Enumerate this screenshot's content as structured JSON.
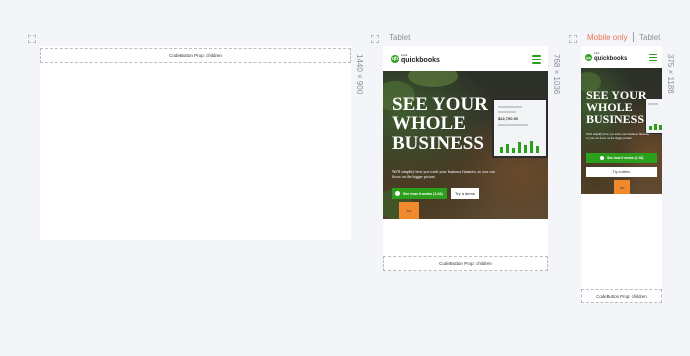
{
  "views": {
    "desktop": {
      "size_label": "1440 × 900",
      "codebutton_text": "CodeButton Prop: children"
    },
    "tablet": {
      "title": "Tablet",
      "size_label": "768 × 1036",
      "brand_small": "intuit",
      "brand": "quickbooks",
      "headline": "SEE YOUR WHOLE BUSINESS",
      "subtext": "We'll simplify how you track your business finances, so you can focus on the bigger picture.",
      "cta_primary": "See how it works (1:34)",
      "cta_secondary": "Try a demo",
      "orange_label": "Tab",
      "laptop_amount": "$22,700.00",
      "codebutton_text": "CodeButton Prop: children"
    },
    "mobile": {
      "mode_label": "Mobile only",
      "tablet_label": "Tablet",
      "size_label": "375 × 1188",
      "brand_small": "intuit",
      "brand": "quickbooks",
      "headline": "SEE YOUR WHOLE BUSINESS",
      "subtext": "We'll simplify how you track your business finances, so you can focus on the bigger picture.",
      "cta_primary": "See how it works (1:34)",
      "cta_secondary": "Try a demo",
      "orange_label": "Tab",
      "codebutton_text": "CodeButton Prop: children"
    }
  },
  "icons": {
    "expand": "expand-corners-icon",
    "play": "play-circle-icon",
    "menu": "hamburger-menu-icon",
    "logo": "quickbooks-logo-icon"
  },
  "colors": {
    "brand_green": "#2ca01c",
    "accent_orange": "#f18a2c",
    "active_label": "#e8735a",
    "canvas": "#f4f5f8"
  }
}
